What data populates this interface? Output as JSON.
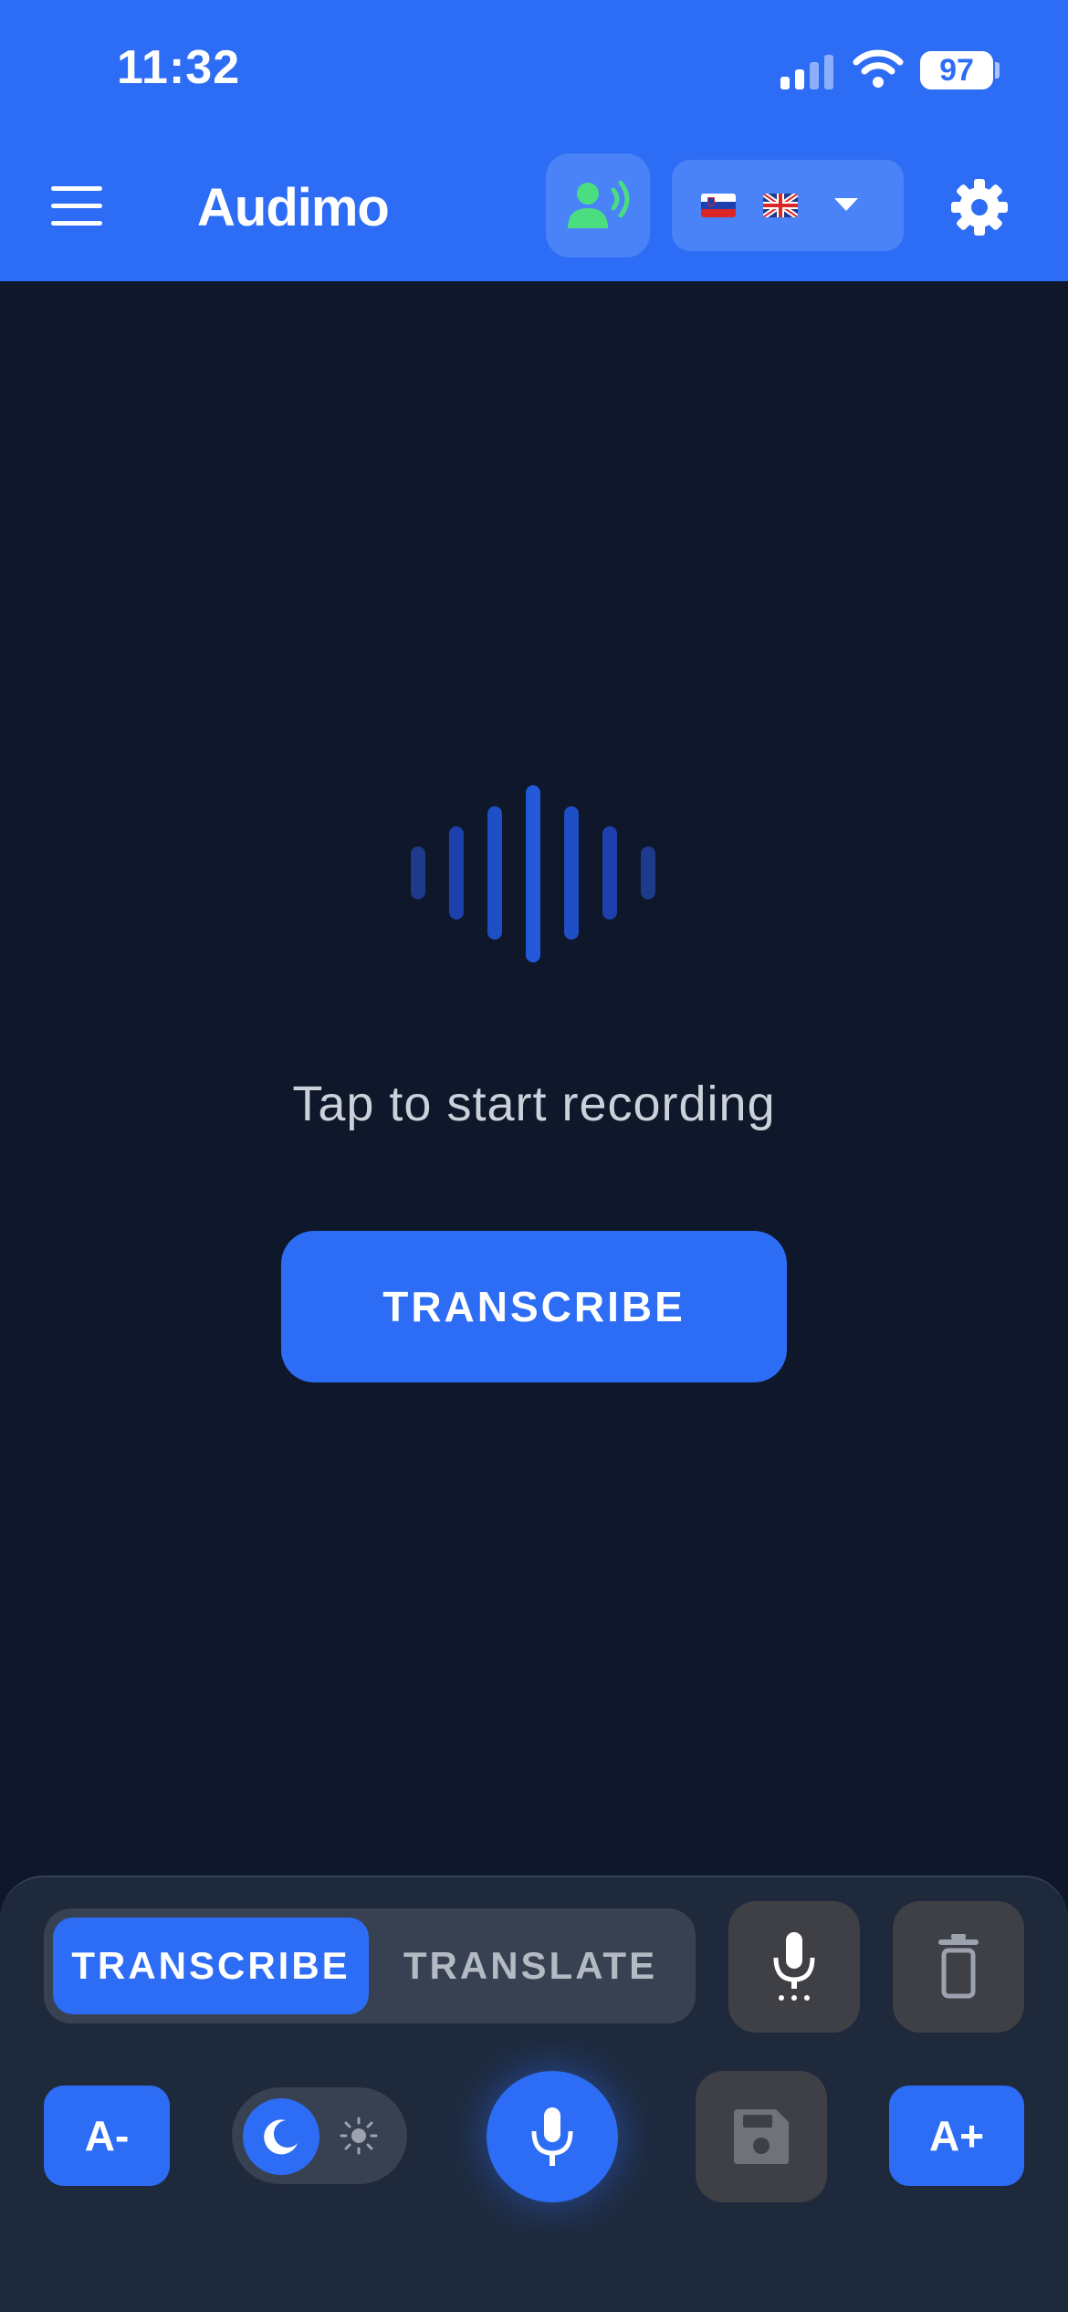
{
  "status_bar": {
    "time": "11:32",
    "battery": "97"
  },
  "header": {
    "title": "Audimo",
    "source_flag": "slovenia-flag",
    "target_flag": "uk-flag"
  },
  "main": {
    "prompt": "Tap to start recording",
    "button_label": "TRANSCRIBE"
  },
  "bottom": {
    "modes": [
      "TRANSCRIBE",
      "TRANSLATE"
    ],
    "active_mode": "TRANSCRIBE",
    "font_decrease": "A-",
    "font_increase": "A+",
    "theme": "dark"
  },
  "colors": {
    "accent": "#2d6df6",
    "background": "#0f172a",
    "panel": "#1e293b",
    "speaker_icon": "#4ade80"
  }
}
